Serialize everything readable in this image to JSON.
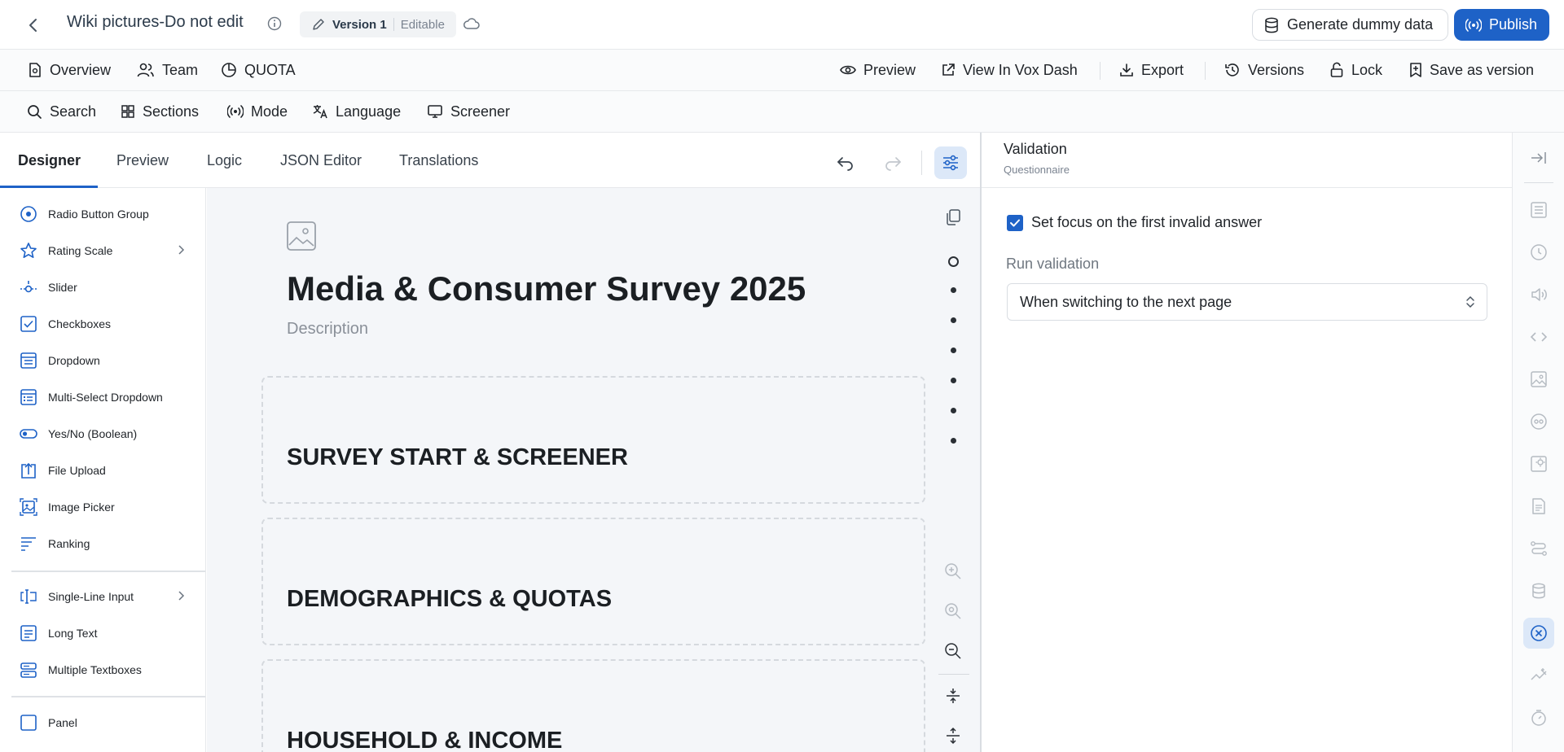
{
  "header": {
    "title": "Wiki pictures-Do not edit",
    "version_label": "Version 1",
    "version_state": "Editable",
    "generate_label": "Generate dummy data",
    "publish_label": "Publish"
  },
  "toolbar": {
    "overview": "Overview",
    "team": "Team",
    "quota": "QUOTA",
    "preview": "Preview",
    "view_in": "View In Vox Dash",
    "export": "Export",
    "versions": "Versions",
    "lock": "Lock",
    "save_as_version": "Save as version"
  },
  "toolbar2": {
    "search": "Search",
    "sections": "Sections",
    "mode": "Mode",
    "language": "Language",
    "screener": "Screener"
  },
  "tabs": {
    "designer": "Designer",
    "preview": "Preview",
    "logic": "Logic",
    "json": "JSON Editor",
    "translations": "Translations"
  },
  "toolbox": {
    "items": [
      {
        "label": "Radio Button Group",
        "icon": "radio-icon"
      },
      {
        "label": "Rating Scale",
        "icon": "star-icon"
      },
      {
        "label": "Slider",
        "icon": "slider-icon"
      },
      {
        "label": "Checkboxes",
        "icon": "checkbox-icon"
      },
      {
        "label": "Dropdown",
        "icon": "dropdown-icon"
      },
      {
        "label": "Multi-Select Dropdown",
        "icon": "multi-select-icon"
      },
      {
        "label": "Yes/No (Boolean)",
        "icon": "toggle-icon"
      },
      {
        "label": "File Upload",
        "icon": "upload-icon"
      },
      {
        "label": "Image Picker",
        "icon": "image-picker-icon"
      },
      {
        "label": "Ranking",
        "icon": "ranking-icon"
      },
      {
        "label": "Single-Line Input",
        "icon": "text-cursor-icon"
      },
      {
        "label": "Long Text",
        "icon": "long-text-icon"
      },
      {
        "label": "Multiple Textboxes",
        "icon": "multi-textbox-icon"
      },
      {
        "label": "Panel",
        "icon": "panel-icon"
      }
    ]
  },
  "canvas": {
    "title": "Media & Consumer Survey 2025",
    "description": "Description",
    "pages": [
      {
        "title": "SURVEY START & SCREENER"
      },
      {
        "title": "DEMOGRAPHICS & QUOTAS"
      },
      {
        "title": "HOUSEHOLD & INCOME"
      }
    ]
  },
  "properties": {
    "title": "Validation",
    "subtitle": "Questionnaire",
    "checkbox_label": "Set focus on the first invalid answer",
    "checkbox_checked": true,
    "run_validation_label": "Run validation",
    "run_validation_value": "When switching to the next page"
  },
  "colors": {
    "accent": "#1e62c7",
    "canvas_bg": "#f4f6f9"
  }
}
